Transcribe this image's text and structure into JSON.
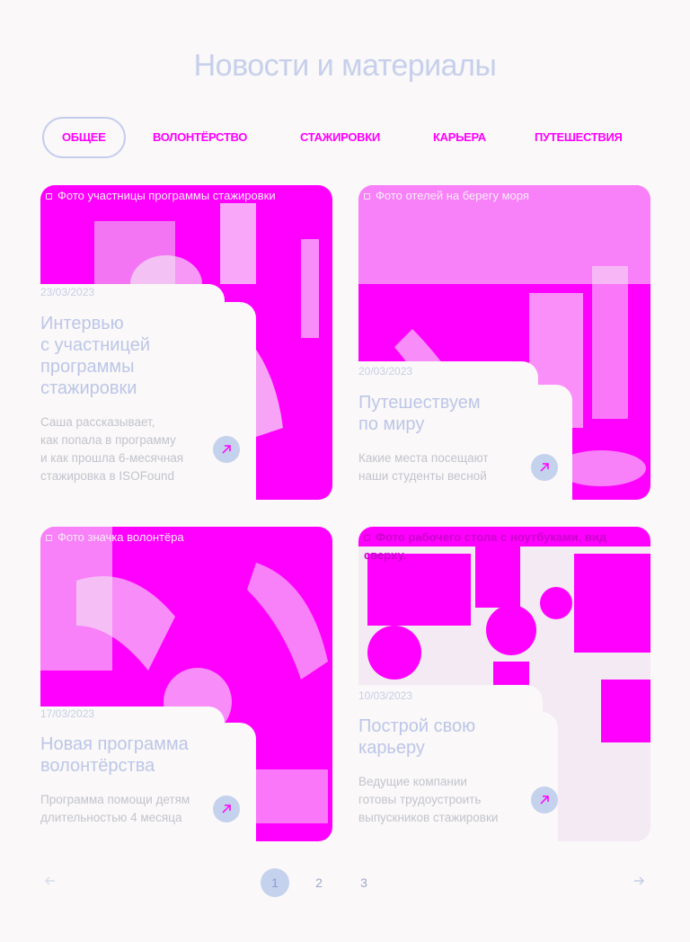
{
  "page": {
    "title": "Новости и материалы"
  },
  "tabs": [
    {
      "label": "ОБЩЕЕ",
      "active": true
    },
    {
      "label": "ВОЛОНТЁРСТВО",
      "active": false
    },
    {
      "label": "СТАЖИРОВКИ",
      "active": false
    },
    {
      "label": "КАРЬЕРА",
      "active": false
    },
    {
      "label": "ПУТЕШЕСТВИЯ",
      "active": false
    }
  ],
  "cards": [
    {
      "photo_alt": "Фото участницы программы стажировки",
      "date": "23/03/2023",
      "title": "Интервью с участницей программы стажировки",
      "title_lines": [
        "Интервью",
        "с участницей",
        "программы",
        "стажировки"
      ],
      "desc_lines": [
        "Саша рассказывает,",
        "как попала в программу",
        "и как прошла 6-месячная",
        "стажировка в ISOFound"
      ]
    },
    {
      "photo_alt": "Фото отелей на берегу моря",
      "date": "20/03/2023",
      "title": "Путешествуем по миру",
      "title_lines": [
        "Путешествуем",
        "по миру"
      ],
      "desc_lines": [
        "Какие места посещают",
        "наши студенты весной"
      ]
    },
    {
      "photo_alt": "Фото значка волонтёра",
      "date": "17/03/2023",
      "title": "Новая программа волонтёрства",
      "title_lines": [
        "Новая программа",
        "волонтёрства"
      ],
      "desc_lines": [
        "Программа помощи детям",
        "длительностью 4 месяца"
      ]
    },
    {
      "photo_alt": "Фото рабочего стола с ноутбуками, вид сверху.",
      "date": "10/03/2023",
      "title": "Построй свою карьеру",
      "title_lines": [
        "Построй свою",
        "карьеру"
      ],
      "desc_lines": [
        "Ведущие компании",
        "готовы трудоустроить",
        "выпускников стажировки"
      ]
    }
  ],
  "pagination": {
    "pages": [
      "1",
      "2",
      "3"
    ],
    "current_page": "1",
    "prev_icon": "arrow-left-icon",
    "next_icon": "arrow-right-icon"
  },
  "colors": {
    "background": "#faf8f8",
    "accent": "#ff00ff",
    "muted_blue": "#c5d2ee"
  }
}
